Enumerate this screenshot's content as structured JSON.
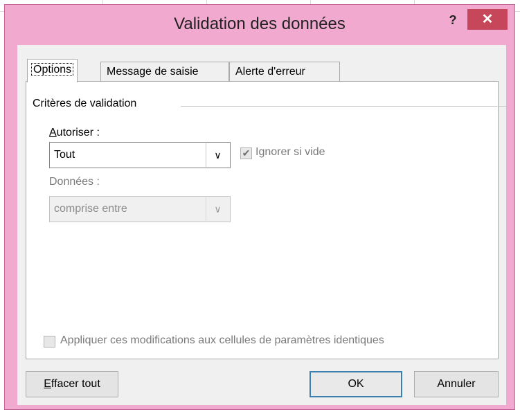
{
  "dialog": {
    "title": "Validation des données",
    "help_glyph": "?",
    "close_glyph": "✕"
  },
  "tabs": [
    {
      "label": "Options",
      "active": true
    },
    {
      "label": "Message de saisie",
      "active": false
    },
    {
      "label": "Alerte d'erreur",
      "active": false
    }
  ],
  "criteria": {
    "group_title": "Critères de validation",
    "allow_label_first": "A",
    "allow_label_rest": "utoriser :",
    "allow_value": "Tout",
    "ignore_blank_label": "Ignorer si vide",
    "ignore_blank_checked": true,
    "data_label": "Données :",
    "data_value": "comprise entre",
    "dropdown_glyph": "∨"
  },
  "apply_all": {
    "label": "Appliquer ces modifications aux cellules de paramètres identiques",
    "checked": false
  },
  "buttons": {
    "clear_first": "E",
    "clear_rest": "ffacer tout",
    "ok": "OK",
    "cancel": "Annuler"
  },
  "check_glyph": "✔"
}
